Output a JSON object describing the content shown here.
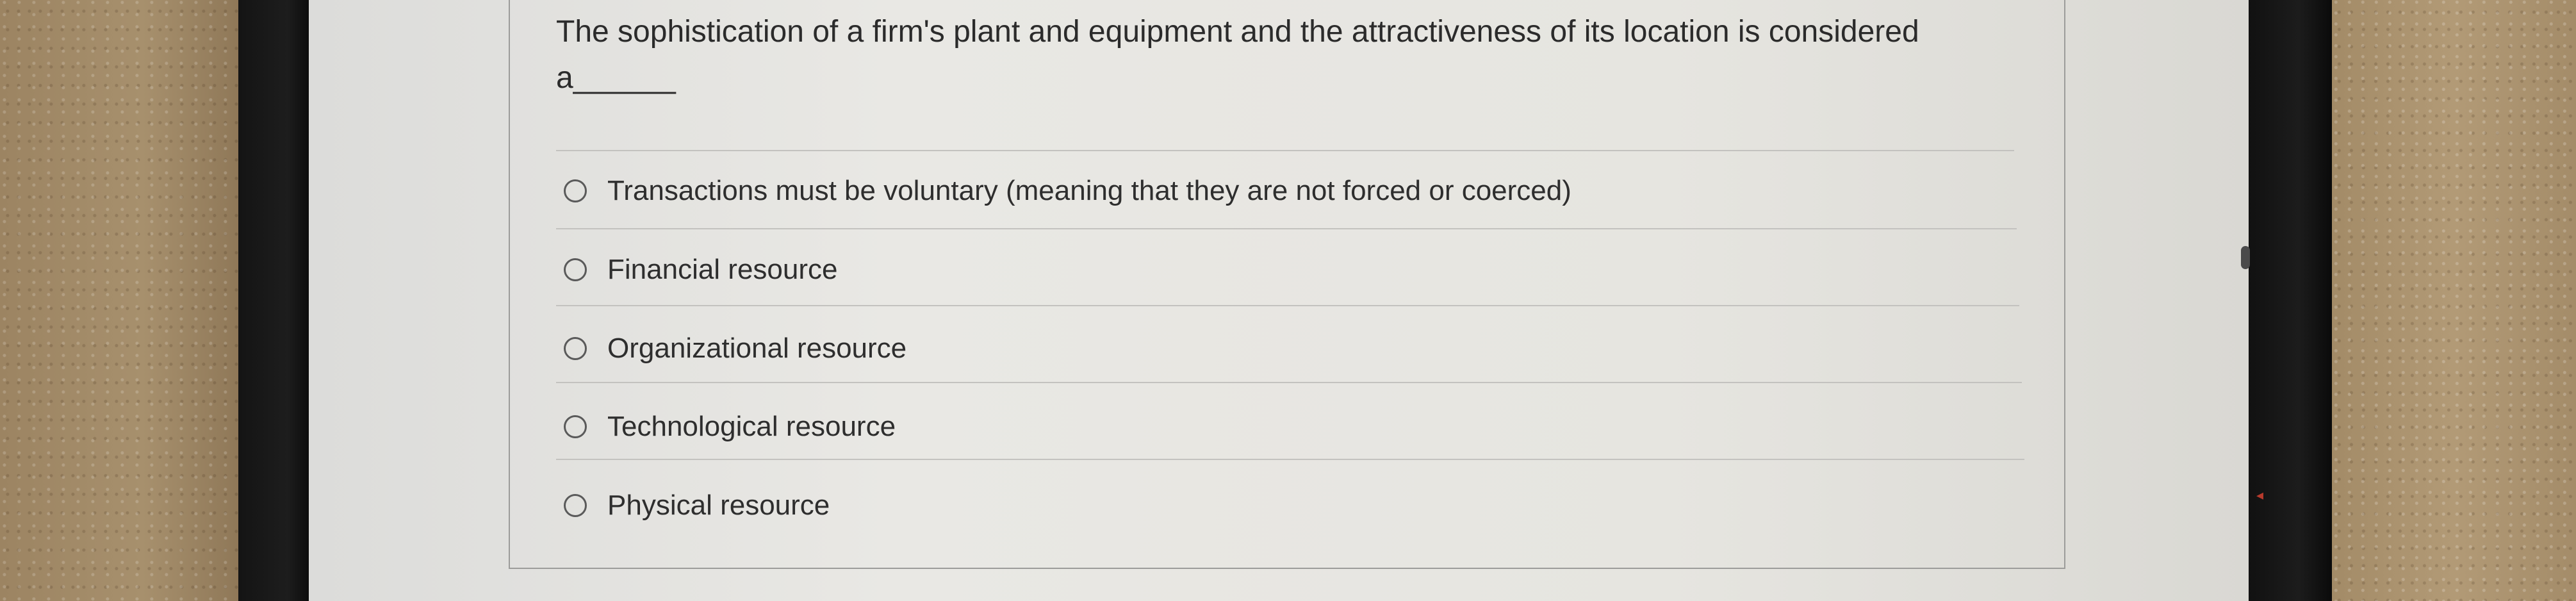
{
  "question": {
    "text": "The sophistication of a firm's plant and equipment and the attractiveness of its location is considered a______"
  },
  "options": [
    {
      "label": "Transactions must be voluntary (meaning that they are not forced or coerced)"
    },
    {
      "label": "Financial resource"
    },
    {
      "label": "Organizational resource"
    },
    {
      "label": "Technological resource"
    },
    {
      "label": "Physical resource"
    }
  ],
  "colors": {
    "screen": "#e6e5e0",
    "text": "#2b2b2b",
    "divider": "#c3c2bf",
    "bezel": "#1a1a1a",
    "wall": "#a8916e"
  },
  "icons": {
    "option_marker": "radio-circle-icon",
    "scroll_thumb": "scrollbar-thumb",
    "cursor": "red-cursor-icon"
  }
}
